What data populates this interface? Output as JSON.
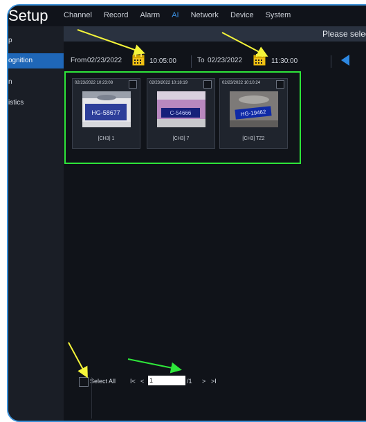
{
  "app": {
    "title": "Setup"
  },
  "topnav": [
    "Channel",
    "Record",
    "Alarm",
    "AI",
    "Network",
    "Device",
    "System"
  ],
  "topnav_active": "AI",
  "sidebar": {
    "items": [
      {
        "label": "p"
      },
      {
        "label": "ognition"
      },
      {
        "label": "n"
      },
      {
        "label": "istics"
      }
    ],
    "active_index": 1
  },
  "content_header": {
    "hint": "Please select lic"
  },
  "filter": {
    "from_label": "From",
    "from_date": "02/23/2022",
    "from_time": "10:05:00",
    "to_label": "To",
    "to_date": "02/23/2022",
    "to_time": "11:30:00"
  },
  "results": [
    {
      "timestamp": "02/23/2022 10:23:08",
      "label": "[CH3] 1",
      "plate": "HG-58677"
    },
    {
      "timestamp": "02/23/2022 10:18:19",
      "label": "[CH3] 7",
      "plate": "C-54666"
    },
    {
      "timestamp": "02/23/2022 10:10:24",
      "label": "[CH3] TZ2",
      "plate": "HG-19462"
    }
  ],
  "footer": {
    "select_all": "Select All",
    "first": "I<",
    "prev": "<",
    "page": "1",
    "total": "/1",
    "next": ">",
    "last": ">I"
  },
  "colors": {
    "accent": "#3b8fe0",
    "highlight_box": "#2ee63a",
    "arrow_yellow": "#f5f53a",
    "arrow_green": "#2ee63a",
    "calendar": "#f2c21a"
  }
}
